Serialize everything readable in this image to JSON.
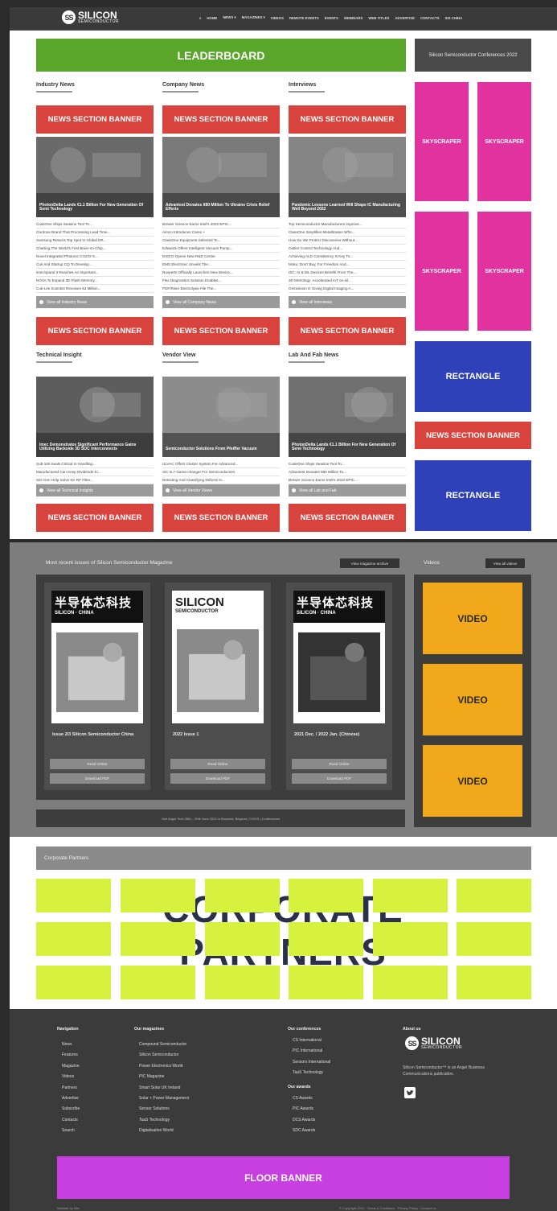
{
  "brand": {
    "mark": "SS",
    "name": "SILICON",
    "sub": "SEMICONDUCTOR"
  },
  "nav": [
    "⌕",
    "HOME",
    "NEWS ▾",
    "MAGAZINES ▾",
    "VIDEOS",
    "REMOTE EVENTS",
    "EVENTS",
    "WEBINARS",
    "WEB TITLES",
    "ADVERTISE",
    "CONTACTS",
    "SIS CHINA"
  ],
  "leaderboard": "LEADERBOARD",
  "top_ad": "Silicon Semiconductor Conferences 2022",
  "skyscraper": "SKYSCRAPER",
  "rectangle": "RECTANGLE",
  "banner": "NEWS SECTION BANNER",
  "sections": [
    {
      "title": "Industry News",
      "caption": "PhotonDelta Lands €1.1 Billion For New Generation Of Semi Technology",
      "links": [
        "CodeOne Ships Seasine Tool To...",
        "Gordone Brand That Processing Lead Time...",
        "Samsung Returns Top Spot In Global DR...",
        "Charting The World's First Brain-on-Chip...",
        "Novel Integrated Photonic CO2/O-S...",
        "Cuk And Startup CQ To Develop...",
        "imec/xpand it Reaches An Important...",
        "NOVA To Expand 3D Flash Memory...",
        "Cuk-Leti Scientist Receives €3 Million..."
      ],
      "viewall": "View all Industry News"
    },
    {
      "title": "Company News",
      "caption": "Advantest Donates ¥80 Million To Ukraine Crisis Relief Efforts",
      "links": [
        "Brewer Science Earns Intel's 2022 EPIC...",
        "Aimco Introduces Cares +",
        "ClassOne Equipment Selected To...",
        "Edwards Offers Intelligent Vacuum Pump...",
        "DISCO Opens New R&D Centre",
        "EMS Electronic Unveils The...",
        "Nuvperts Officially Launches New Device...",
        "Flex Diagnostics Solution Enables...",
        "PDF/Riser Electrolysis File The..."
      ],
      "viewall": "View all Company News"
    },
    {
      "title": "Interviews",
      "caption": "Pandemic Lessons Learned Will Shape IC Manufacturing Well Beyond 2022",
      "links": [
        "Top Semiconductor Manufacturers Improve...",
        "ClassOne Simplifies Metallization Wfrs...",
        "How Do We Protect Discoveries Without...",
        "Outlier Control Technology And...",
        "Achieving ALD Consistency Is Key To...",
        "Moku: Don't Buy, For Freedom And...",
        "ISC: AI & ML Devices Benefit From The...",
        "3D Metrology: Accelerated IoT on-sil...",
        "Omnivision Is Giving Digital Imaging A..."
      ],
      "viewall": "View all Interviews"
    },
    {
      "title": "Technical Insight",
      "caption": "Imec Demonstrates Significant Performance Gains Utilizing Backside 3D SOC Interconnects",
      "links": [
        "Sub-100 Seals Critical In Handling...",
        "Manufactured Can Keep Dividends Ki...",
        "SiO Gen Help Solve 5G RF Filter..."
      ],
      "viewall": "View all Technical Insights"
    },
    {
      "title": "Vendor View",
      "caption": "Semiconductor Solutions From Pfeiffer Vacuum",
      "links": [
        "ULVAC Offers Cluster System For Advanced...",
        "SiC Is A Game-changer For Semiconductors",
        "Detecting And Classifying Defects In..."
      ],
      "viewall": "View all Vendor Views"
    },
    {
      "title": "Lab And Fab News",
      "caption": "PhotonDelta Lands €1.1 Billion For New Generation Of Semi Technology",
      "links": [
        "CodeOne Ships Seasine Tool To...",
        "Advantest Donates ¥80 Million To...",
        "Brewer Science Earns Intel's 2022 EPIC..."
      ],
      "viewall": "View all Lab and Fab"
    }
  ],
  "magazine": {
    "title": "Most recent issues of Silicon Semiconductor Magazine",
    "archive_btn": "View magazine archive",
    "issues": [
      {
        "cover_title": "半导体芯科技",
        "cover_sub": "SILICON · CHINA",
        "name": "Issue 2/3 Silicon Semiconductor China",
        "btn1": "Read Online",
        "btn2": "Download PDF"
      },
      {
        "cover_title": "SILICON",
        "cover_sub": "SEMICONDUCTOR",
        "name": "2022 Issue 1",
        "btn1": "Read Online",
        "btn2": "Download PDF"
      },
      {
        "cover_title": "半导体芯科技",
        "cover_sub": "SILICON · CHINA",
        "name": "2021 Dec. / 2022 Jan. (Chinese)",
        "btn1": "Read Online",
        "btn2": "Download PDF"
      }
    ],
    "event_bar": "Visit Angel Tech 28th – 30th June 2022 in Brussels, Belgium | CS/SS | Conferences"
  },
  "videos": {
    "title": "Videos",
    "btn": "View all videos",
    "label": "VIDEO"
  },
  "partners": {
    "header": "Corporate Partners",
    "line1": "CORPORATE",
    "line2": "PARTNERS"
  },
  "footer": {
    "nav_title": "Navigation",
    "nav": [
      "News",
      "Features",
      "Magazine",
      "Videos",
      "Partners",
      "Advertise",
      "Subscribe",
      "Contacts",
      "Search"
    ],
    "mags_title": "Our magazines",
    "mags": [
      "Compound Semiconductor",
      "Silicon Semiconductor",
      "Power Electronics World",
      "PIC Magazine",
      "Smart Solar UK Ireland",
      "Solar + Power Management",
      "Sensor Solutions",
      "TaaS Technology",
      "Digitalisation World"
    ],
    "conf_title": "Our conferences",
    "conf": [
      "CS International",
      "PIC International",
      "Sensors International",
      "TaaS Technology"
    ],
    "awards_title": "Our awards",
    "awards": [
      "CS Awards",
      "PIC Awards",
      "DCS Awards",
      "SDC Awards"
    ],
    "about_title": "About us",
    "about_text": "Silicon Semiconductor™ is an Angel Business Communications publication.",
    "floor": "FLOOR BANNER",
    "copyright": "© Copyright 2022 · Terms & Conditions · Privacy Policy · Contact us",
    "credit": "Website by Site"
  }
}
